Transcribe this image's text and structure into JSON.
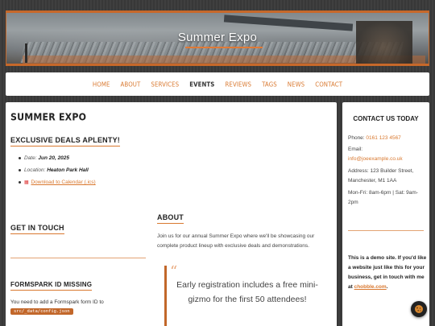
{
  "hero": {
    "title": "Summer Expo"
  },
  "nav": {
    "items": [
      {
        "label": "Home"
      },
      {
        "label": "About"
      },
      {
        "label": "Services"
      },
      {
        "label": "Events"
      },
      {
        "label": "Reviews"
      },
      {
        "label": "Tags"
      },
      {
        "label": "News"
      },
      {
        "label": "Contact"
      }
    ],
    "active": "Events"
  },
  "main": {
    "title": "Summer Expo",
    "deals_heading": "Exclusive Deals Aplenty!",
    "details": {
      "date_label": "Date:",
      "date_value": "Jun 20, 2025",
      "location_label": "Location:",
      "location_value": "Heaton Park Hall",
      "calendar_link": "Download to Calendar (.ics)"
    },
    "get_in_touch_heading": "Get in Touch",
    "formspark_heading": "Formspark ID Missing",
    "formspark_note": "You need to add a Formspark form ID to",
    "formspark_code": "src/_data/config.json",
    "about_heading": "About",
    "about_text": "Join us for our annual Summer Expo where we'll be showcasing our complete product lineup with exclusive deals and demonstrations.",
    "quote": "Early registration includes a free mini-gizmo for the first 50 attendees!"
  },
  "sidebar": {
    "heading": "Contact Us Today",
    "phone_label": "Phone:",
    "phone": "0161 123 4567",
    "email_label": "Email:",
    "email": "info@joeexample.co.uk",
    "address": "Address: 123 Builder Street, Manchester, M1 1AA",
    "hours": "Mon-Fri: 8am-6pm | Sat: 9am-2pm",
    "demo_text": "This is a demo site. If you'd like a website just like this for your business, get in touch with me at",
    "demo_link": "chobble.com",
    "demo_end": "."
  },
  "colors": {
    "accent": "#d9782f",
    "code_bg": "#c2672a",
    "background": "#3a3a3a"
  },
  "icons": {
    "calendar": "calendar-icon",
    "cookie": "cookie-icon",
    "quote": "quote-icon"
  }
}
